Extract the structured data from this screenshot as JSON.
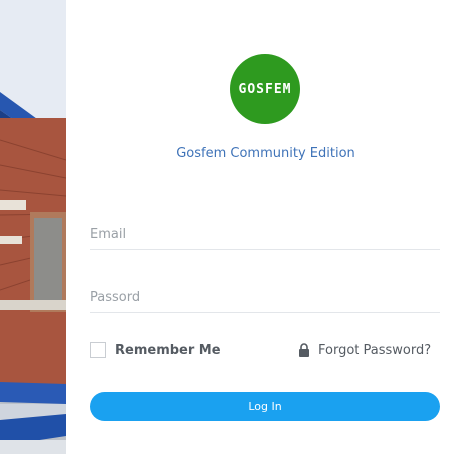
{
  "brand": {
    "logo_text": "GOSFEM",
    "logo_color": "#2e9a1f",
    "edition_label": "Gosfem Community Edition",
    "edition_color": "#3f73b8"
  },
  "form": {
    "email_placeholder": "Email",
    "password_placeholder": "Passord",
    "remember_label": "Remember Me",
    "forgot_label": "Forgot Password?",
    "login_label": "Log In",
    "login_color": "#1aa1f0"
  },
  "icons": {
    "lock": "lock-icon",
    "checkbox": "checkbox-unchecked"
  }
}
